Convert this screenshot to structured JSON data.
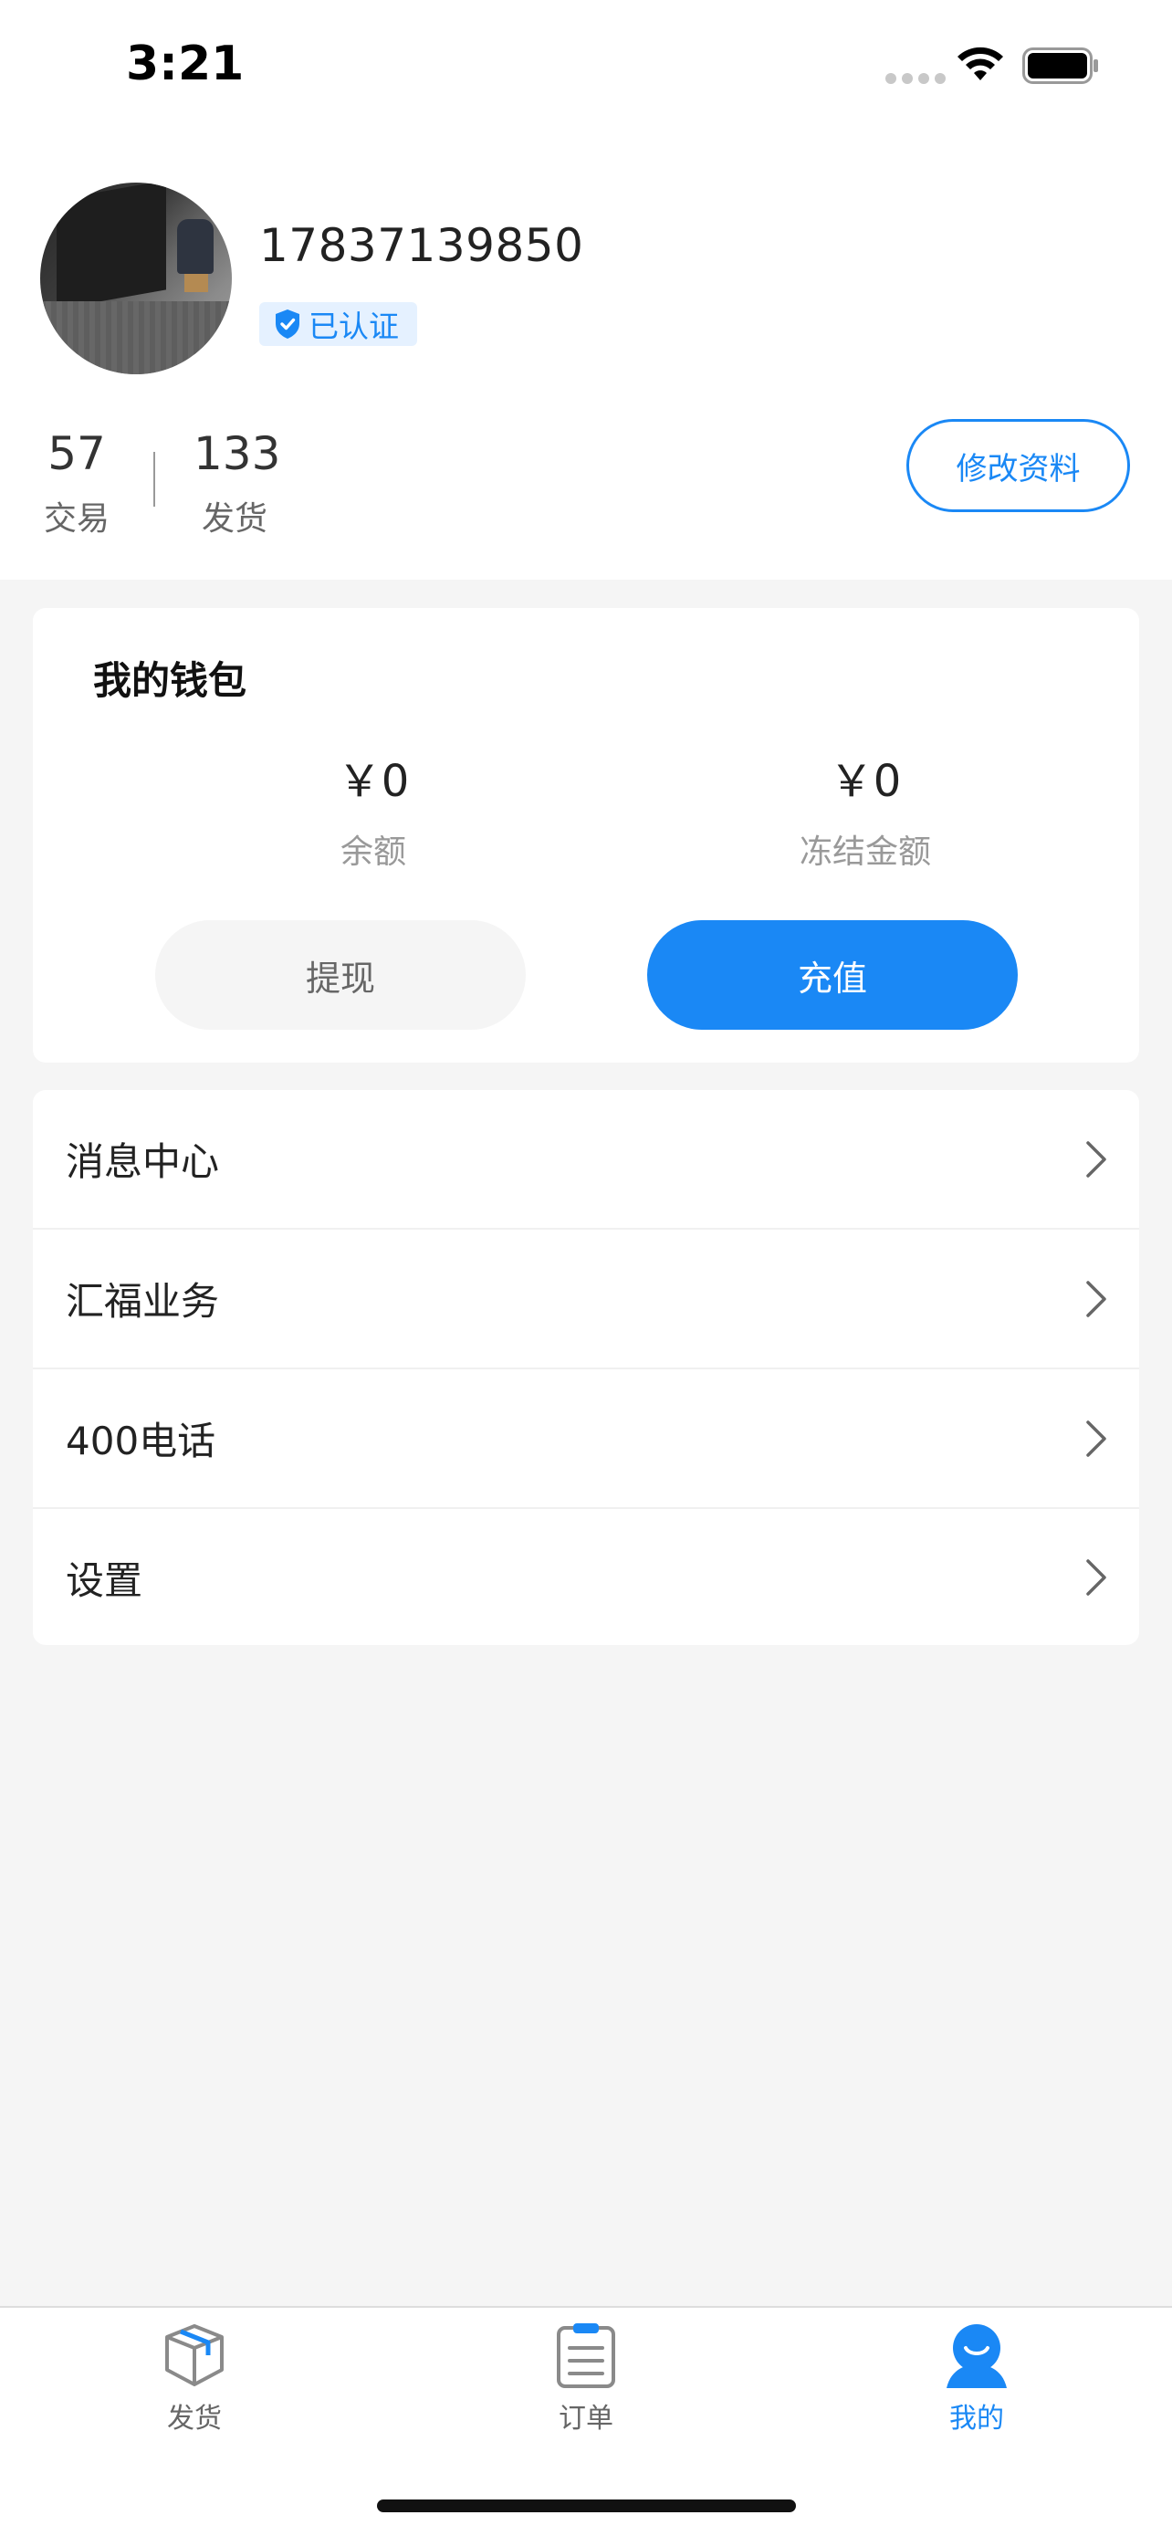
{
  "status_bar": {
    "time": "3:21",
    "icons": [
      "cellular-dots-icon",
      "wifi-icon",
      "battery-icon"
    ]
  },
  "profile": {
    "phone": "17837139850",
    "verified_label": "已认证",
    "stats": [
      {
        "value": "57",
        "label": "交易"
      },
      {
        "value": "133",
        "label": "发货"
      }
    ],
    "edit_button_label": "修改资料"
  },
  "wallet": {
    "title": "我的钱包",
    "balance_amount": "￥0",
    "balance_label": "余额",
    "frozen_amount": "￥0",
    "frozen_label": "冻结金额",
    "withdraw_label": "提现",
    "recharge_label": "充值"
  },
  "menu": {
    "items": [
      {
        "label": "消息中心"
      },
      {
        "label": "汇福业务"
      },
      {
        "label": "400电话"
      },
      {
        "label": "设置"
      }
    ]
  },
  "tabbar": {
    "tabs": [
      {
        "label": "发货",
        "icon": "box-icon",
        "active": false
      },
      {
        "label": "订单",
        "icon": "clipboard-icon",
        "active": false
      },
      {
        "label": "我的",
        "icon": "user-icon",
        "active": true
      }
    ]
  },
  "colors": {
    "accent": "#1a88f5",
    "background": "#f5f5f5",
    "card": "#ffffff"
  }
}
